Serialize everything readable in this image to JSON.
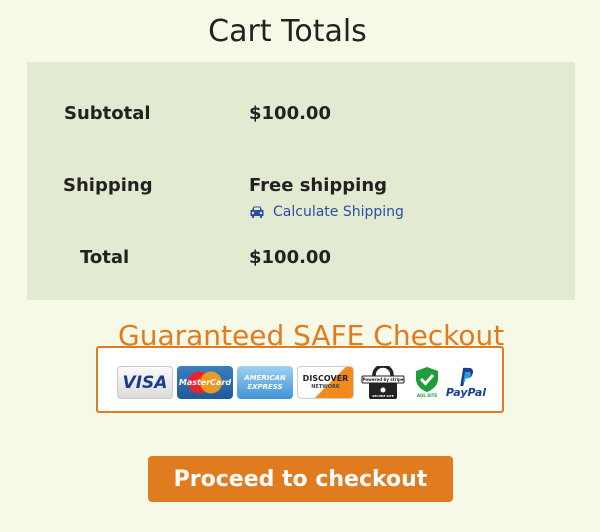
{
  "page": {
    "title": "Cart Totals"
  },
  "totals": {
    "subtotal_label": "Subtotal",
    "subtotal_value": "$100.00",
    "shipping_label": "Shipping",
    "shipping_value": "Free shipping",
    "calculate_shipping_link": "Calculate Shipping",
    "total_label": "Total",
    "total_value": "$100.00"
  },
  "safe_checkout": {
    "heading": "Guaranteed SAFE Checkout",
    "badges": {
      "visa": "VISA",
      "mastercard": "MasterCard",
      "amex_line1": "AMERICAN",
      "amex_line2": "EXPRESS",
      "discover": "DISCOVER",
      "discover_sub": "NETWORK",
      "stripe_top": "Powered by stripe",
      "stripe_bottom": "SECURE SITE",
      "verified": "AOL SITE",
      "paypal": "PayPal"
    }
  },
  "actions": {
    "checkout_label": "Proceed to checkout"
  },
  "colors": {
    "accent": "#e07c1f",
    "background": "#f5f9e6",
    "panel": "#e2ebd1",
    "link": "#2b4fa0"
  }
}
